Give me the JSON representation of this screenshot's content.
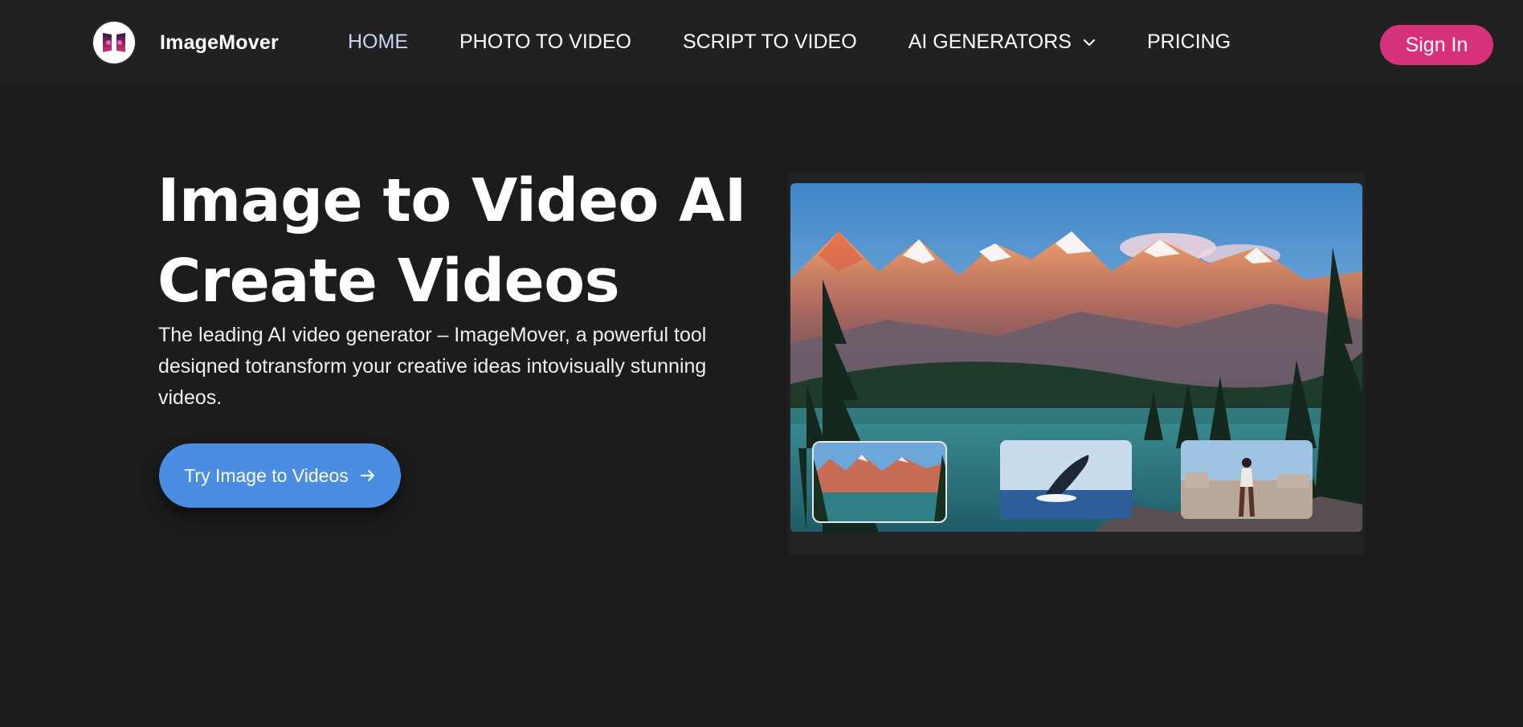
{
  "header": {
    "brand_name": "ImageMover",
    "nav": [
      {
        "label": "HOME",
        "active": true
      },
      {
        "label": "PHOTO TO VIDEO"
      },
      {
        "label": "SCRIPT TO VIDEO"
      },
      {
        "label": "AI GENERATORS",
        "has_dropdown": true
      },
      {
        "label": "PRICING"
      }
    ],
    "sign_in_label": "Sign In"
  },
  "hero": {
    "title_line1": "Image to Video AI",
    "title_line2": "Create Videos",
    "description": "The leading AI video generator – ImageMover, a powerful tool desiqned totransform your creative ideas intovisually stunning videos.",
    "cta_label": "Try Image to Videos",
    "cta_icon": "arrow-right-icon"
  },
  "preview": {
    "main_image": "mountain-lake-scene",
    "thumbnails": [
      {
        "name": "mountain-lake",
        "selected": true
      },
      {
        "name": "breaching-whale",
        "selected": false
      },
      {
        "name": "person-on-rooftop",
        "selected": false
      }
    ]
  },
  "colors": {
    "page_bg": "#1c1c1c",
    "header_bg": "#212121",
    "accent_pink": "#d6317a",
    "accent_blue": "#4a8de3",
    "active_nav": "#c9d4f7"
  }
}
